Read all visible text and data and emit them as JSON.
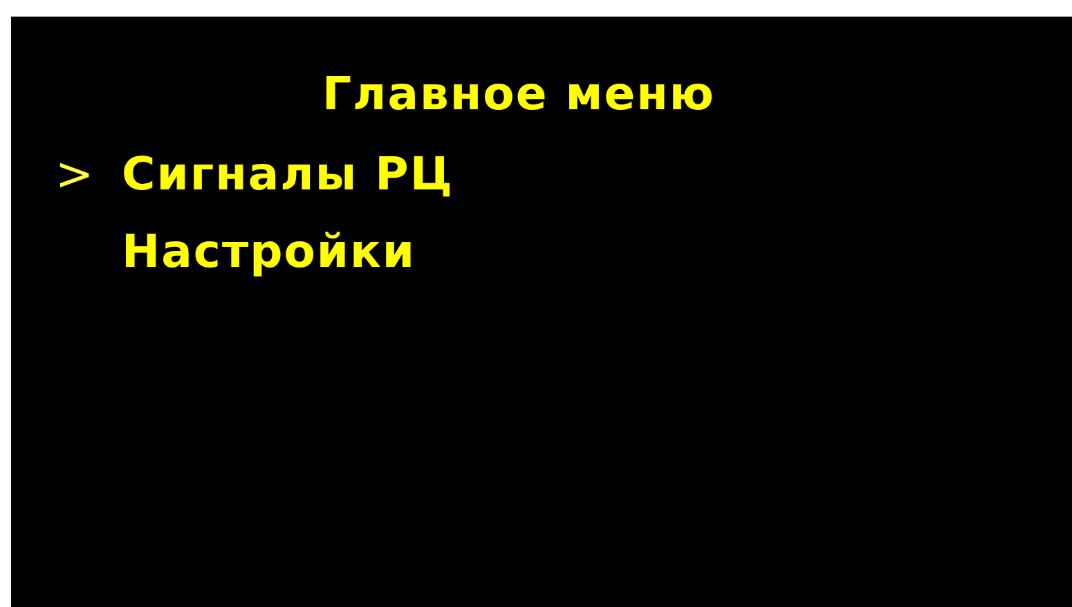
{
  "title": "Главное меню",
  "cursor": ">",
  "menu_items": [
    {
      "label": "Сигналы РЦ",
      "selected": true
    },
    {
      "label": "Настройки",
      "selected": false
    }
  ]
}
